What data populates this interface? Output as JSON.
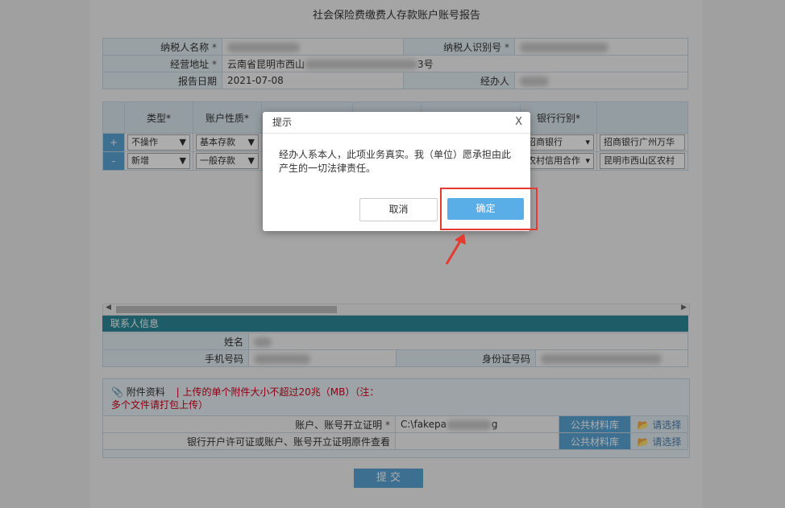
{
  "page_title": "社会保险费缴费人存款账户账号报告",
  "taxpayer": {
    "name_label": "纳税人名称",
    "id_label": "纳税人识别号",
    "address_label": "经营地址",
    "address_value_start": "云南省昆明市西山",
    "address_value_end": "3号",
    "date_label": "报告日期",
    "date_value": "2021-07-08",
    "handler_label": "经办人",
    "required_mark": "*"
  },
  "accounts": {
    "headers": [
      "类型*",
      "账户性质*",
      "",
      "",
      "",
      "银行行别*",
      ""
    ],
    "rows": [
      {
        "pm": "+",
        "type": "不操作",
        "nature": "基本存款",
        "bank": "招商银行",
        "branch": "招商银行广州万华"
      },
      {
        "pm": "-",
        "type": "新增",
        "nature": "一般存款",
        "bank": "农村信用合作",
        "branch": "昆明市西山区农村"
      }
    ]
  },
  "contact": {
    "section_title": "联系人信息",
    "name_label": "姓名",
    "phone_label": "手机号码",
    "id_label": "身份证号码"
  },
  "attachments": {
    "label": "附件资料",
    "note_line1": "上传的单个附件大小不超过20兆（MB）（注：",
    "note_line2": "多个文件请打包上传）",
    "rows": [
      {
        "label": "账户、账号开立证明",
        "required": "*",
        "file_start": "C:\\fakepa",
        "file_end": "g",
        "library_button": "公共材料库",
        "select_button": "请选择"
      },
      {
        "label": "银行开户许可证或账户、账号开立证明原件查看",
        "required": "",
        "file_start": "",
        "file_end": "",
        "library_button": "公共材料库",
        "select_button": "请选择"
      }
    ]
  },
  "submit_label": "提 交",
  "dialog": {
    "title": "提示",
    "close": "X",
    "message": "经办人系本人，此项业务真实。我（单位）愿承担由此产生的一切法律责任。",
    "cancel": "取消",
    "confirm": "确定"
  }
}
